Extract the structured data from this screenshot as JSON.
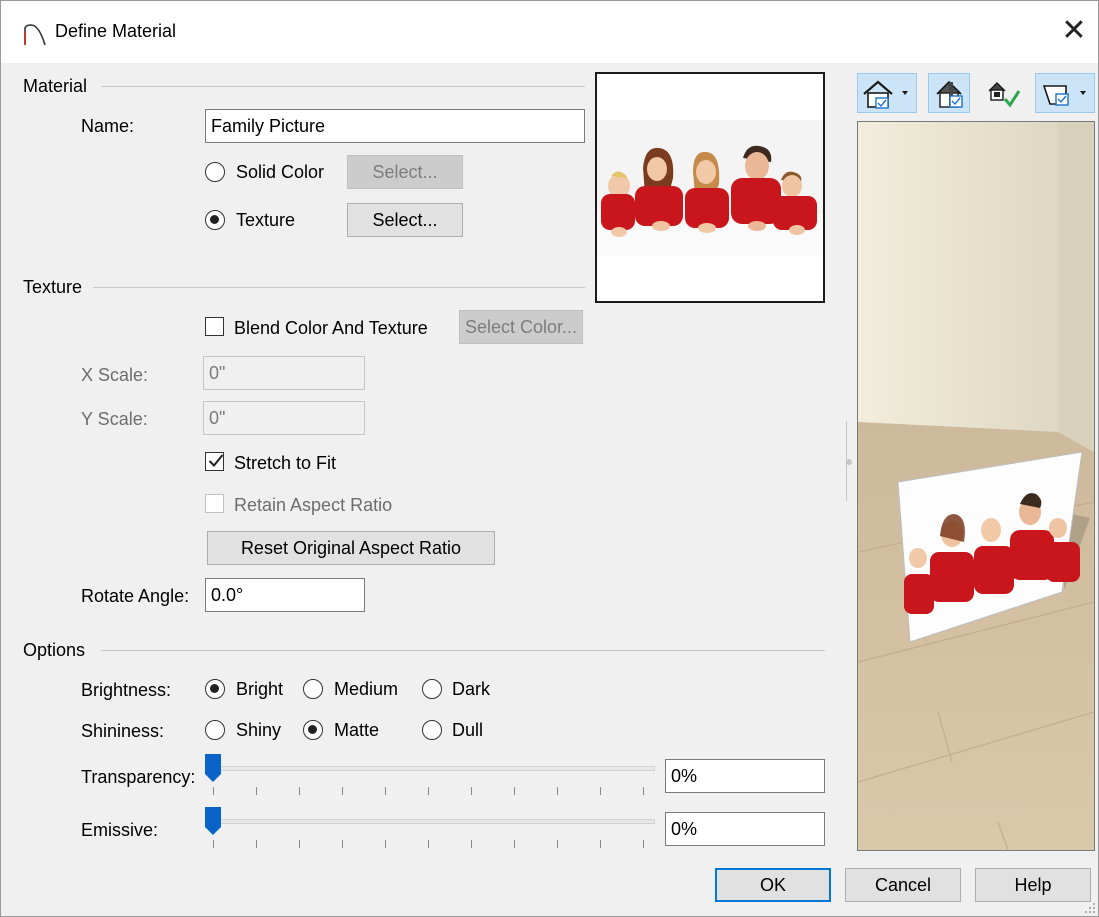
{
  "window": {
    "title": "Define Material",
    "close_glyph": "✕"
  },
  "material": {
    "group_label": "Material",
    "name_label": "Name:",
    "name_value": "Family Picture",
    "solid_color_label": "Solid Color",
    "texture_label": "Texture",
    "select_label": "Select...",
    "selected_mode": "texture"
  },
  "texture": {
    "group_label": "Texture",
    "blend_label": "Blend Color And Texture",
    "select_color_label": "Select Color...",
    "x_scale_label": "X Scale:",
    "x_scale_value": "0\"",
    "y_scale_label": "Y Scale:",
    "y_scale_value": "0\"",
    "stretch_label": "Stretch to Fit",
    "stretch_checked": true,
    "retain_label": "Retain Aspect Ratio",
    "reset_label": "Reset Original Aspect Ratio",
    "rotate_label": "Rotate Angle:",
    "rotate_value": "0.0°"
  },
  "options": {
    "group_label": "Options",
    "brightness_label": "Brightness:",
    "brightness_options": [
      "Bright",
      "Medium",
      "Dark"
    ],
    "brightness_selected": "Bright",
    "shininess_label": "Shininess:",
    "shininess_options": [
      "Shiny",
      "Matte",
      "Dull"
    ],
    "shininess_selected": "Matte",
    "transparency_label": "Transparency:",
    "transparency_value": "0%",
    "transparency_fraction": 0,
    "emissive_label": "Emissive:",
    "emissive_value": "0%",
    "emissive_fraction": 0
  },
  "buttons": {
    "ok": "OK",
    "cancel": "Cancel",
    "help": "Help"
  },
  "icons": {
    "title": "arch-icon",
    "toolbar": [
      "camera-view-icon",
      "dropdown-arrow-icon",
      "layer-toggle-icon",
      "material-check-icon",
      "display-mode-icon"
    ]
  },
  "colors": {
    "accent": "#0078d7",
    "slider_thumb": "#0a64c8",
    "shirt_red": "#c8161c"
  }
}
